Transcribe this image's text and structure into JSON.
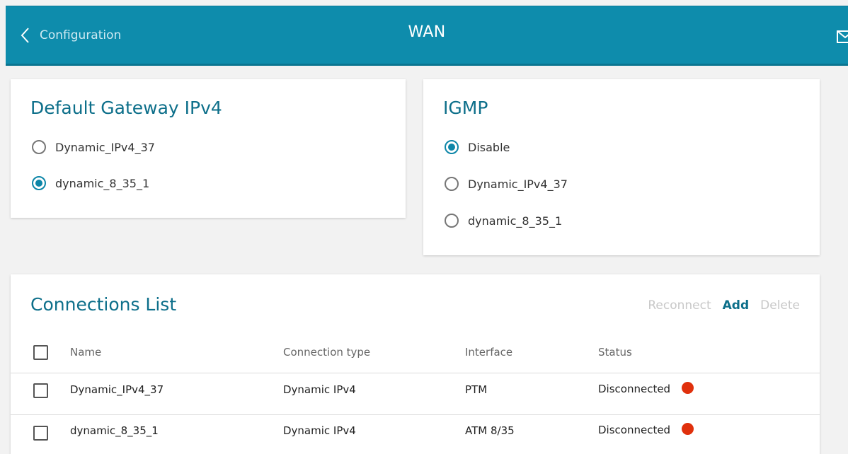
{
  "header": {
    "back_label": "Configuration",
    "title": "WAN",
    "back_icon": "chevron-left-icon",
    "mail_icon": "envelope-icon",
    "color": "#0e8cac"
  },
  "gateway": {
    "title": "Default Gateway IPv4",
    "options": [
      {
        "label": "Dynamic_IPv4_37",
        "selected": false
      },
      {
        "label": "dynamic_8_35_1",
        "selected": true
      }
    ]
  },
  "igmp": {
    "title": "IGMP",
    "options": [
      {
        "label": "Disable",
        "selected": true
      },
      {
        "label": "Dynamic_IPv4_37",
        "selected": false
      },
      {
        "label": "dynamic_8_35_1",
        "selected": false
      }
    ]
  },
  "connections": {
    "title": "Connections List",
    "actions": {
      "reconnect": "Reconnect",
      "add": "Add",
      "delete": "Delete"
    },
    "columns": {
      "name": "Name",
      "type": "Connection type",
      "interface": "Interface",
      "status": "Status"
    },
    "rows": [
      {
        "name": "Dynamic_IPv4_37",
        "type": "Dynamic IPv4",
        "interface": "PTM",
        "status": "Disconnected",
        "status_color": "#e0300c"
      },
      {
        "name": "dynamic_8_35_1",
        "type": "Dynamic IPv4",
        "interface": "ATM 8/35",
        "status": "Disconnected",
        "status_color": "#e0300c"
      }
    ]
  }
}
